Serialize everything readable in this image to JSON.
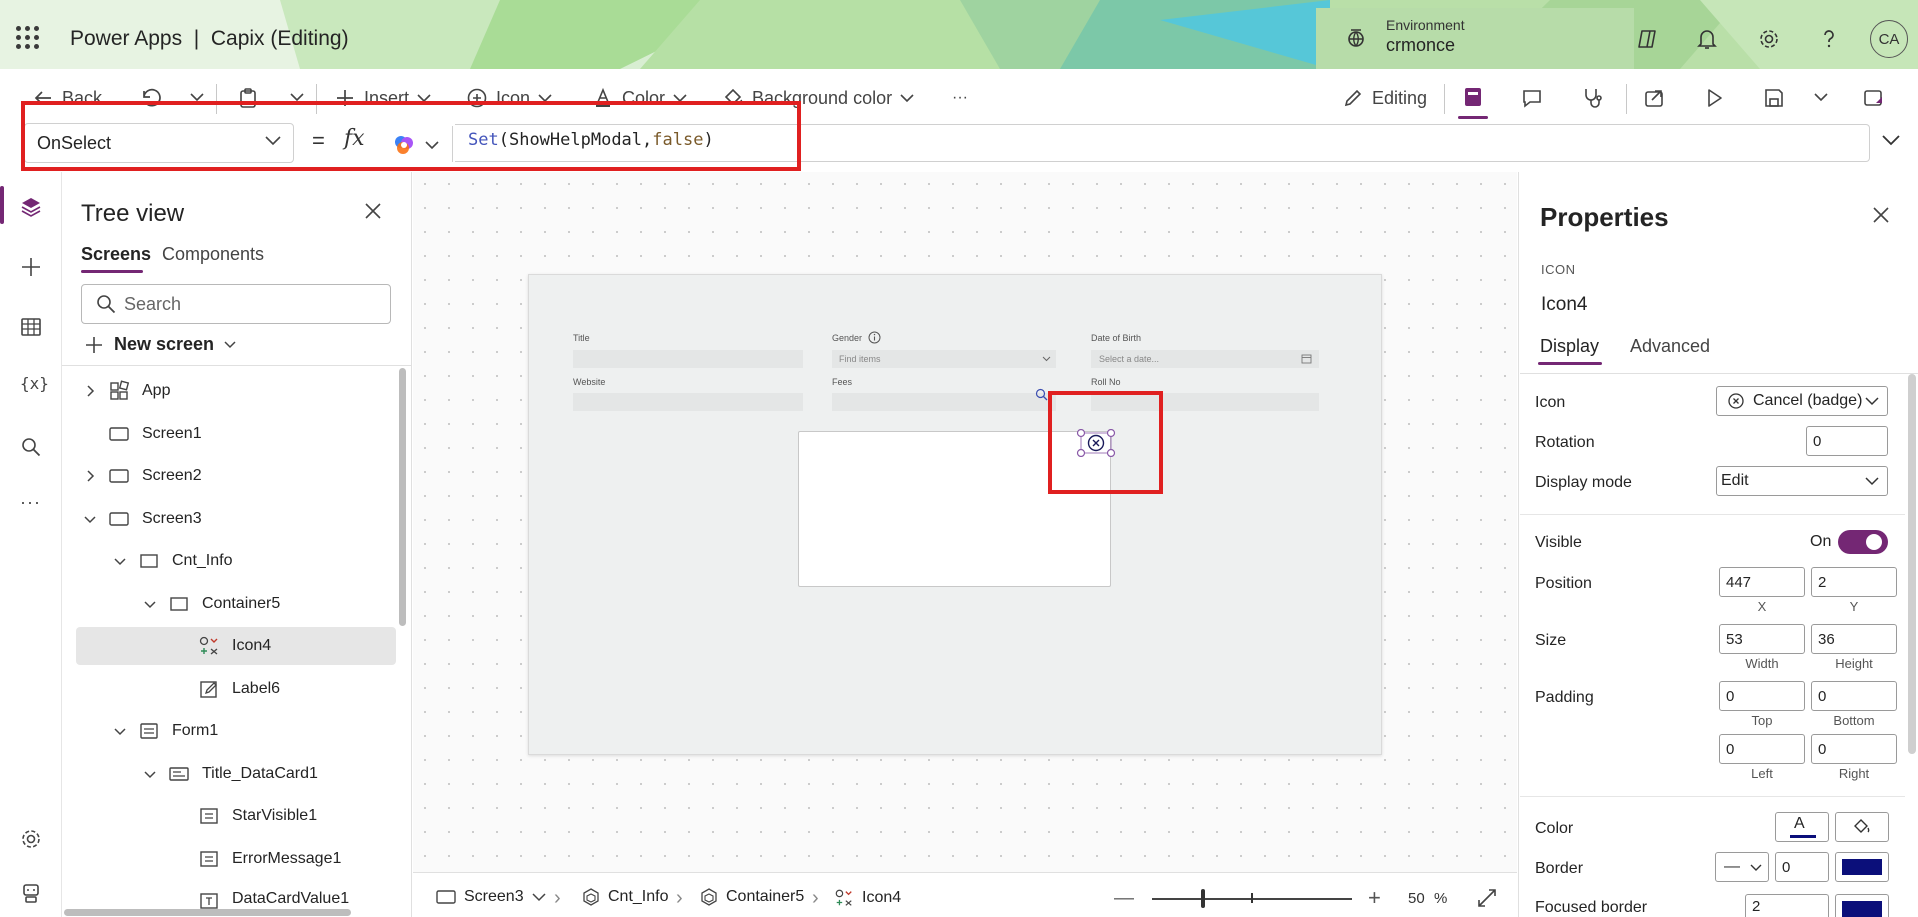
{
  "header": {
    "app_title": "Power Apps  |  Capix (Editing)",
    "environment_label": "Environment",
    "environment_value": "crmonce",
    "avatar_initials": "CA",
    "brand_color": "#742774"
  },
  "toolbar": {
    "back": "Back",
    "insert": "Insert",
    "icon": "Icon",
    "color": "Color",
    "background_color": "Background color",
    "more": "···",
    "editing": "Editing"
  },
  "formula_bar": {
    "property": "OnSelect",
    "equals": "=",
    "fx": "fx",
    "formula_fn": "Set",
    "formula_open": "(",
    "formula_arg1": "ShowHelpModal",
    "formula_comma": ",",
    "formula_arg2": "false",
    "formula_close": ")"
  },
  "tree": {
    "title": "Tree view",
    "tab_screens": "Screens",
    "tab_components": "Components",
    "search_placeholder": "Search",
    "new_screen": "New screen",
    "items": [
      {
        "label": "App"
      },
      {
        "label": "Screen1"
      },
      {
        "label": "Screen2"
      },
      {
        "label": "Screen3"
      },
      {
        "label": "Cnt_Info"
      },
      {
        "label": "Container5"
      },
      {
        "label": "Icon4"
      },
      {
        "label": "Label6"
      },
      {
        "label": "Form1"
      },
      {
        "label": "Title_DataCard1"
      },
      {
        "label": "StarVisible1"
      },
      {
        "label": "ErrorMessage1"
      },
      {
        "label": "DataCardValue1"
      }
    ]
  },
  "canvas": {
    "fields": {
      "title": "Title",
      "gender": "Gender",
      "gender_placeholder": "Find items",
      "dob": "Date of Birth",
      "dob_placeholder": "Select a date...",
      "website": "Website",
      "fees": "Fees",
      "roll_no": "Roll No"
    }
  },
  "breadcrumb": {
    "screen": "Screen3",
    "container": "Cnt_Info",
    "inner_container": "Container5",
    "control": "Icon4",
    "zoom_minus": "—",
    "zoom_plus": "+",
    "zoom_value": "50",
    "zoom_unit": "%"
  },
  "properties": {
    "title": "Properties",
    "control_type": "ICON",
    "control_name": "Icon4",
    "tab_display": "Display",
    "tab_advanced": "Advanced",
    "icon_label": "Icon",
    "icon_value": "Cancel (badge)",
    "rotation_label": "Rotation",
    "rotation_value": "0",
    "display_mode_label": "Display mode",
    "display_mode_value": "Edit",
    "visible_label": "Visible",
    "visible_state": "On",
    "position_label": "Position",
    "position_x": "447",
    "position_y": "2",
    "x_label": "X",
    "y_label": "Y",
    "size_label": "Size",
    "width": "53",
    "height": "36",
    "width_label": "Width",
    "height_label": "Height",
    "padding_label": "Padding",
    "padding_top": "0",
    "padding_bottom": "0",
    "padding_left": "0",
    "padding_right": "0",
    "top_label": "Top",
    "bottom_label": "Bottom",
    "left_label": "Left",
    "right_label": "Right",
    "color_label": "Color",
    "color_glyph": "A",
    "border_label": "Border",
    "border_style": "—",
    "border_width": "0",
    "border_color": "#0b0f7a",
    "focused_border_label": "Focused border",
    "focused_border_width": "2",
    "focused_border_color": "#0b0f7a"
  }
}
